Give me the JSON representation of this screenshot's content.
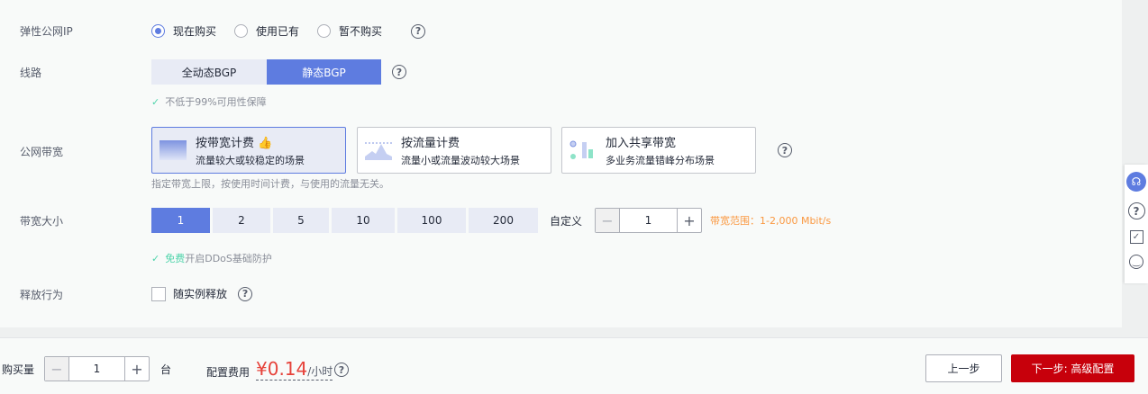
{
  "eip": {
    "label": "弹性公网IP",
    "options": [
      "现在购买",
      "使用已有",
      "暂不购买"
    ],
    "selected": 0
  },
  "line": {
    "label": "线路",
    "options": [
      "全动态BGP",
      "静态BGP"
    ],
    "selected": 1,
    "note": "不低于99%可用性保障"
  },
  "bandwidth_type": {
    "label": "公网带宽",
    "cards": [
      {
        "title": "按带宽计费",
        "sub": "流量较大或较稳定的场景"
      },
      {
        "title": "按流量计费",
        "sub": "流量小或流量波动较大场景"
      },
      {
        "title": "加入共享带宽",
        "sub": "多业务流量错峰分布场景"
      }
    ],
    "selected": 0,
    "note": "指定带宽上限，按使用时间计费，与使用的流量无关。"
  },
  "bandwidth_size": {
    "label": "带宽大小",
    "options": [
      "1",
      "2",
      "5",
      "10",
      "100",
      "200"
    ],
    "selected": 0,
    "custom_label": "自定义",
    "value": "1",
    "range": "带宽范围：1-2,000 Mbit/s",
    "ddos_free": "免费",
    "ddos_text": "开启DDoS基础防护"
  },
  "release": {
    "label": "释放行为",
    "checkbox": "随实例释放"
  },
  "footer": {
    "qty_label": "购买量",
    "qty": "1",
    "unit": "台",
    "fee_label": "配置费用",
    "price": "¥0.14",
    "price_unit": "/小时",
    "prev": "上一步",
    "next": "下一步: 高级配置"
  },
  "colors": {
    "accent": "#5e7ce0",
    "danger": "#c7000b",
    "price": "#e6423a",
    "warn": "#fa9841"
  },
  "side_icons": [
    "headset-icon",
    "help-icon",
    "feedback-icon",
    "smile-icon"
  ]
}
